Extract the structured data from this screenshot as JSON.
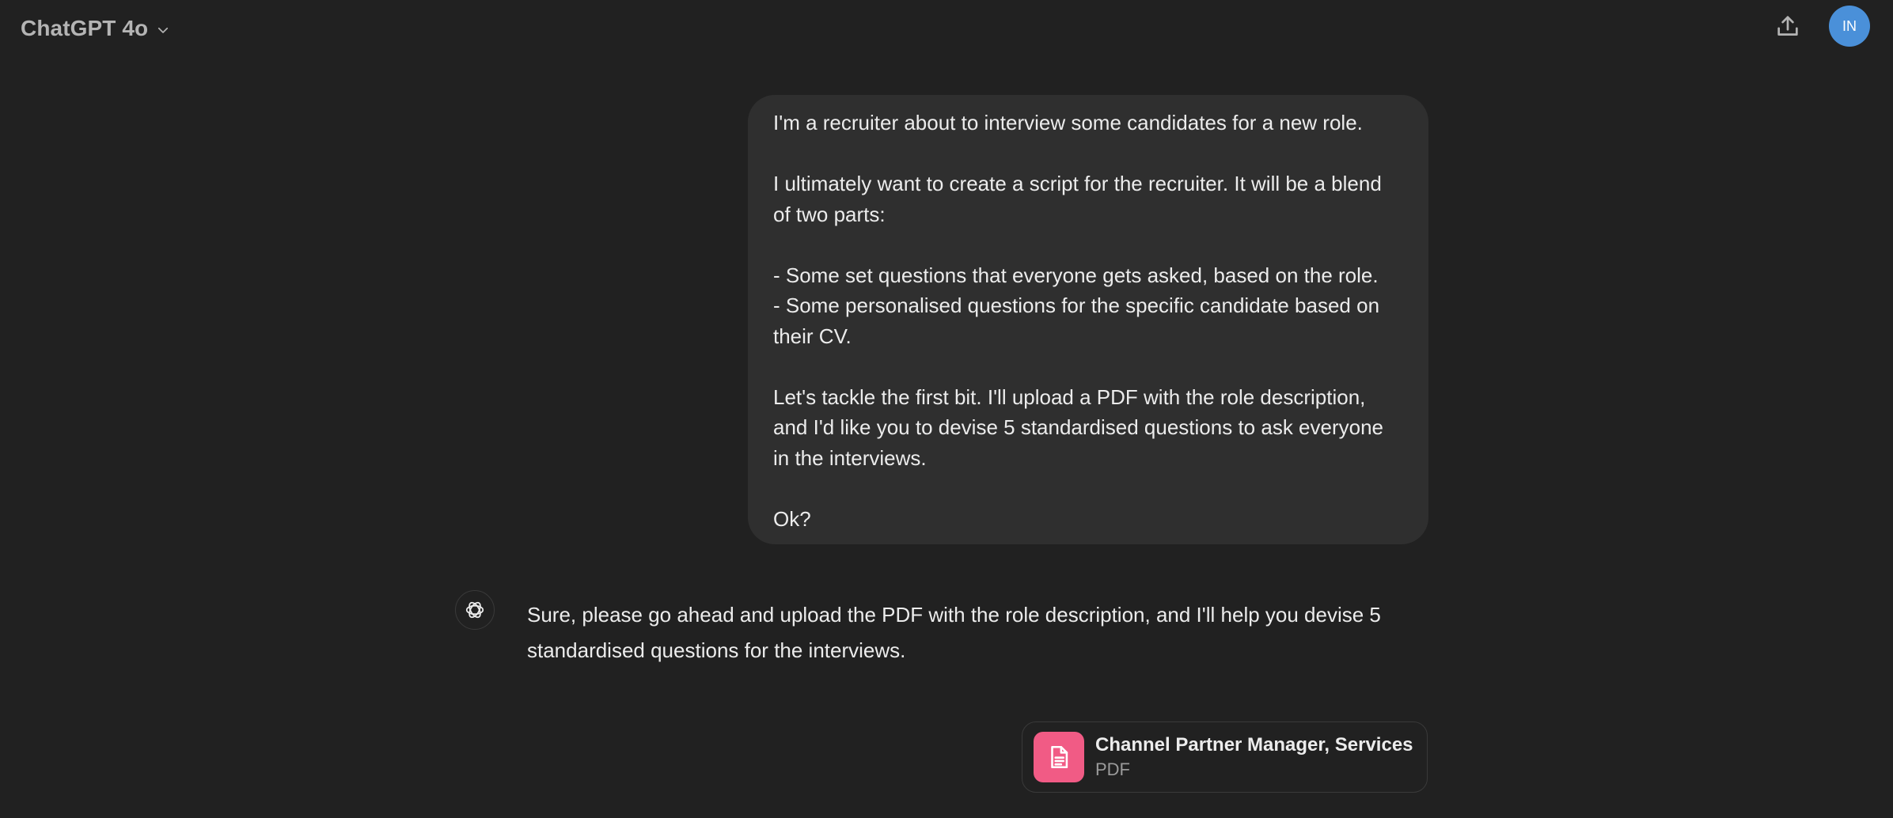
{
  "header": {
    "model_name": "ChatGPT 4o",
    "avatar_initials": "IN",
    "avatar_color": "#4a90d9",
    "icons": {
      "model_dropdown": "chevron-down-icon",
      "share": "share-upload-icon"
    }
  },
  "conversation": {
    "user_message": {
      "paragraphs": [
        "I'm a recruiter about to interview some candidates for a new role.",
        "I ultimately want to create a script for the recruiter. It will be a blend of two parts:",
        "- Some set questions that everyone gets asked, based on the role.",
        "- Some personalised questions for the specific candidate based on their CV.",
        "Let's tackle the first bit. I'll upload a PDF with the role description, and I'd like you to devise 5 standardised questions to ask everyone in the interviews.",
        "Ok?"
      ]
    },
    "assistant_message": {
      "icon": "openai-logo-icon",
      "text": "Sure, please go ahead and upload the PDF with the role description, and I'll help you devise 5 standardised questions for the interviews."
    },
    "attachment": {
      "file_name": "Channel Partner Manager, Services ...",
      "file_type": "PDF",
      "icon": "document-icon",
      "icon_color": "#f15b85"
    }
  }
}
